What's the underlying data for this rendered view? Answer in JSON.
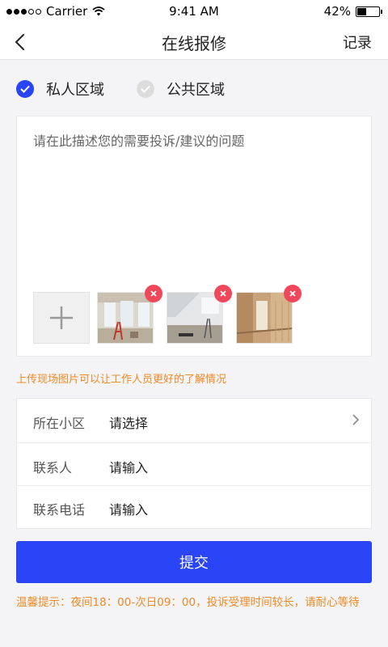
{
  "status": {
    "carrier": "Carrier",
    "time": "9:41 AM",
    "battery": "42%",
    "battery_level": 0.42
  },
  "nav": {
    "title": "在线报修",
    "record": "记录"
  },
  "zones": {
    "private": "私人区域",
    "public": "公共区域",
    "selected": "private"
  },
  "description": {
    "placeholder": "请在此描述您的需要投诉/建议的问题"
  },
  "hint": "上传现场图片可以让工作人员更好的了解情况",
  "form": {
    "community": {
      "label": "所在小区",
      "value": "请选择"
    },
    "contact": {
      "label": "联系人",
      "value": "请输入"
    },
    "phone": {
      "label": "联系电话",
      "value": "请输入"
    }
  },
  "submit": "提交",
  "tip": "温馨提示：夜间18：00-次日09：00，投诉受理时间较长，请耐心等待",
  "colors": {
    "accent": "#2945f5",
    "warning": "#f08a25",
    "delete": "#f0485a"
  }
}
